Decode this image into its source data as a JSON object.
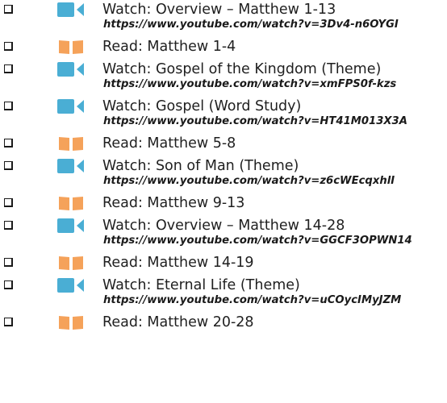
{
  "colors": {
    "video_icon": "#4aaed4",
    "book_icon": "#f5a25a",
    "text": "#1f1f1f"
  },
  "items": [
    {
      "type": "watch",
      "icon": "video-icon",
      "title": "Watch: Overview – Matthew 1-13",
      "url": "https://www.youtube.com/watch?v=3Dv4-n6OYGI"
    },
    {
      "type": "read",
      "icon": "book-icon",
      "title": "Read: Matthew 1-4"
    },
    {
      "type": "watch",
      "icon": "video-icon",
      "title": "Watch: Gospel of the Kingdom (Theme)",
      "url": "https://www.youtube.com/watch?v=xmFPS0f-kzs"
    },
    {
      "type": "watch",
      "icon": "video-icon",
      "title": "Watch: Gospel (Word Study)",
      "url": "https://www.youtube.com/watch?v=HT41M013X3A"
    },
    {
      "type": "read",
      "icon": "book-icon",
      "title": "Read: Matthew 5-8"
    },
    {
      "type": "watch",
      "icon": "video-icon",
      "title": "Watch: Son of Man (Theme)",
      "url": "https://www.youtube.com/watch?v=z6cWEcqxhlI"
    },
    {
      "type": "read",
      "icon": "book-icon",
      "title": "Read: Matthew 9-13"
    },
    {
      "type": "watch",
      "icon": "video-icon",
      "title": "Watch: Overview – Matthew 14-28",
      "url": "https://www.youtube.com/watch?v=GGCF3OPWN14"
    },
    {
      "type": "read",
      "icon": "book-icon",
      "title": "Read: Matthew 14-19"
    },
    {
      "type": "watch",
      "icon": "video-icon",
      "title": "Watch: Eternal Life (Theme)",
      "url": "https://www.youtube.com/watch?v=uCOycIMyJZM"
    },
    {
      "type": "read",
      "icon": "book-icon",
      "title": "Read: Matthew 20-28"
    }
  ]
}
